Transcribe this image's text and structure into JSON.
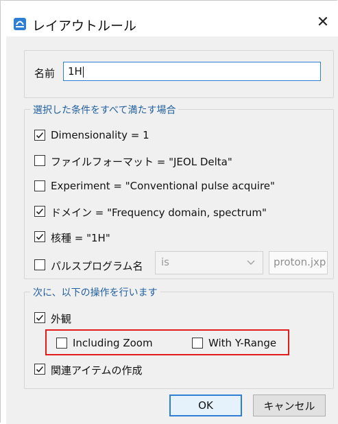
{
  "window": {
    "title": "レイアウトルール",
    "close_glyph": "✕",
    "accent": "#2d7fd6"
  },
  "name_field": {
    "label": "名前",
    "value": "1H"
  },
  "conditions": {
    "legend": "選択した条件をすべて満たす場合",
    "items": [
      {
        "label": "Dimensionality = 1",
        "checked": true
      },
      {
        "label": "ファイルフォーマット = \"JEOL Delta\"",
        "checked": false
      },
      {
        "label": "Experiment = \"Conventional pulse acquire\"",
        "checked": false
      },
      {
        "label": "ドメイン = \"Frequency domain, spectrum\"",
        "checked": true
      },
      {
        "label": "核種 = \"1H\"",
        "checked": true
      },
      {
        "label": "パルスプログラム名",
        "checked": false
      }
    ],
    "pulse_operator": "is",
    "pulse_value": "proton.jxp"
  },
  "actions": {
    "legend": "次に、以下の操作を行います",
    "appearance": {
      "label": "外観",
      "checked": true
    },
    "including_zoom": {
      "label": "Including Zoom",
      "checked": false
    },
    "with_y_range": {
      "label": "With Y-Range",
      "checked": false
    },
    "create_related": {
      "label": "関連アイテムの作成",
      "checked": true
    },
    "highlight_color": "#e31b1b"
  },
  "buttons": {
    "ok": "OK",
    "cancel": "キャンセル"
  }
}
